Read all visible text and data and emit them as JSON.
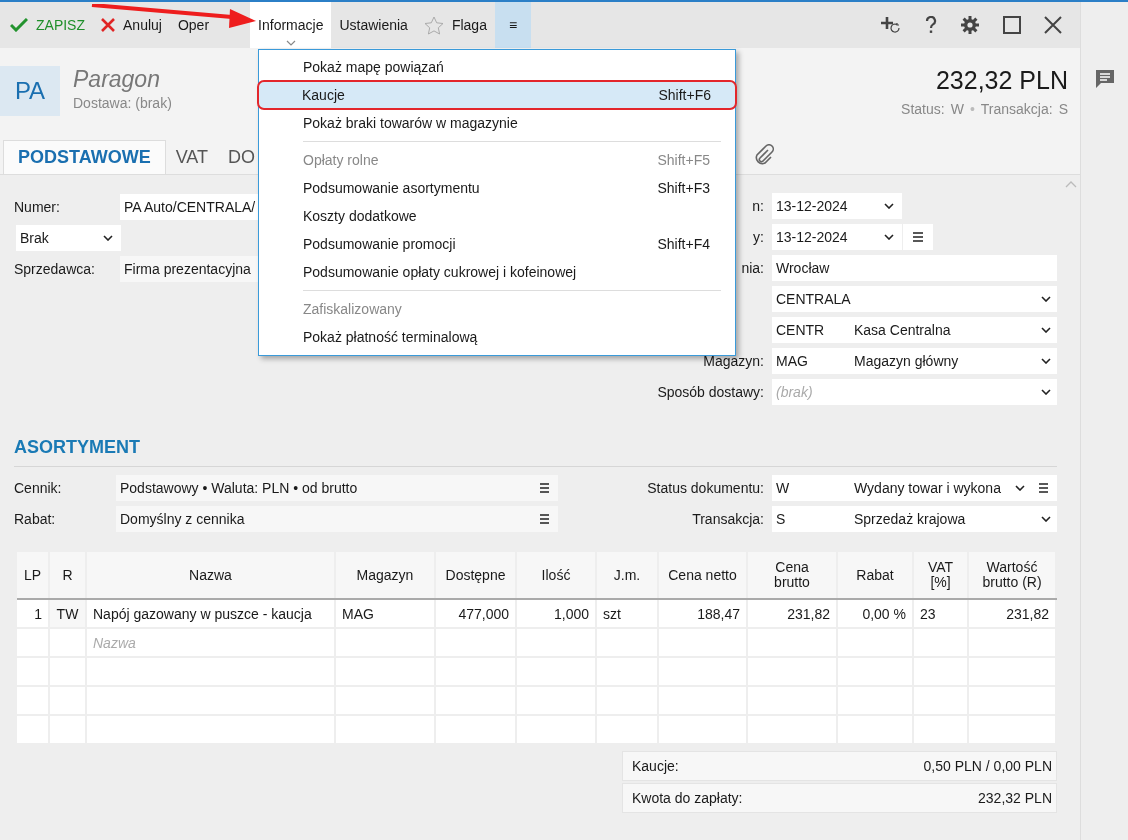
{
  "toolbar": {
    "items": [
      {
        "kind": "save",
        "label": "ZAPISZ",
        "selected": false
      },
      {
        "kind": "cancel",
        "label": "Anuluj",
        "selected": false
      },
      {
        "kind": "plain",
        "label": "Oper",
        "selected": false
      },
      {
        "kind": "dropdown",
        "label": "Informacje",
        "selected": true
      },
      {
        "kind": "plain",
        "label": "Ustawienia",
        "selected": false
      },
      {
        "kind": "flag",
        "label": "Flaga",
        "selected": false
      },
      {
        "kind": "more",
        "label": "≡",
        "selected": false
      }
    ]
  },
  "document": {
    "badge": "PA",
    "title": "Paragon",
    "subtitle": "Dostawa: (brak)",
    "total": "232,32 PLN",
    "status_label": "Status:",
    "status": "W",
    "separator": "•",
    "transaction_label": "Transakcja:",
    "transaction": "S"
  },
  "tabs": [
    {
      "label": "PODSTAWOWE",
      "selected": true
    },
    {
      "label": "VAT",
      "selected": false
    },
    {
      "label": "DO",
      "selected": false
    }
  ],
  "form_left": [
    {
      "kind": "text",
      "label": "Numer:",
      "value": "PA Auto/CENTRALA/"
    },
    {
      "kind": "select",
      "value": "Brak"
    },
    {
      "kind": "readonly",
      "label": "Sprzedawca:",
      "value": "Firma prezentacyjna"
    }
  ],
  "form_right": [
    {
      "kind": "date",
      "label": "n:",
      "value": "13-12-2024"
    },
    {
      "kind": "date_menu",
      "label": "y:",
      "value": "13-12-2024"
    },
    {
      "kind": "text",
      "label": "nia:",
      "value": "Wrocław"
    },
    {
      "kind": "select",
      "value": "CENTRALA"
    },
    {
      "kind": "select",
      "value": "CENTR",
      "name": "Kasa Centralna"
    },
    {
      "kind": "select",
      "label": "Magazyn:",
      "value": "MAG",
      "name": "Magazyn główny"
    },
    {
      "kind": "select",
      "label": "Sposób dostawy:",
      "placeholder": "(brak)"
    }
  ],
  "assortment": {
    "heading": "ASORTYMENT",
    "left": [
      {
        "label": "Cennik:",
        "value": "Podstawowy • Waluta: PLN • od brutto"
      },
      {
        "label": "Rabat:",
        "value": "Domyślny z cennika"
      }
    ],
    "right": [
      {
        "label": "Status dokumentu:",
        "value": "W",
        "name": "Wydany towar i wykona",
        "menu": true
      },
      {
        "label": "Transakcja:",
        "value": "S",
        "name": "Sprzedaż krajowa",
        "menu": false
      }
    ]
  },
  "table": {
    "columns": [
      "LP",
      "R",
      "Nazwa",
      "Magazyn",
      "Dostępne",
      "Ilość",
      "J.m.",
      "Cena netto",
      "Cena brutto",
      "Rabat",
      "VAT [%]",
      "Wartość brutto (R)"
    ],
    "rows": [
      [
        "1",
        "TW",
        "Napój gazowany w puszce - kaucja",
        "MAG",
        "477,000",
        "1,000",
        "szt",
        "188,47",
        "231,82",
        "0,00 %",
        "23",
        "231,82"
      ]
    ],
    "new_row_placeholder": "Nazwa"
  },
  "totals": [
    {
      "label": "Kaucje:",
      "value": "0,50 PLN / 0,00 PLN"
    },
    {
      "label": "Kwota do zapłaty:",
      "value": "232,32 PLN"
    }
  ],
  "menu": {
    "items": [
      {
        "kind": "item",
        "label": "Pokaż mapę powiązań",
        "disabled": false,
        "selected": false,
        "annotated": false
      },
      {
        "kind": "item",
        "label": "Kaucje",
        "shortcut": "Shift+F6",
        "disabled": false,
        "selected": true,
        "annotated": true
      },
      {
        "kind": "item",
        "label": "Pokaż braki towarów w magazynie",
        "disabled": false,
        "selected": false,
        "annotated": false
      },
      {
        "kind": "separator"
      },
      {
        "kind": "item",
        "label": "Opłaty rolne",
        "shortcut": "Shift+F5",
        "disabled": true,
        "selected": false,
        "annotated": false
      },
      {
        "kind": "item",
        "label": "Podsumowanie asortymentu",
        "shortcut": "Shift+F3",
        "disabled": false,
        "selected": false,
        "annotated": false
      },
      {
        "kind": "item",
        "label": "Koszty dodatkowe",
        "disabled": false,
        "selected": false,
        "annotated": false
      },
      {
        "kind": "item",
        "label": "Podsumowanie promocji",
        "shortcut": "Shift+F4",
        "disabled": false,
        "selected": false,
        "annotated": false
      },
      {
        "kind": "item",
        "label": "Podsumowanie opłaty cukrowej i kofeinowej",
        "disabled": false,
        "selected": false,
        "annotated": false
      },
      {
        "kind": "separator"
      },
      {
        "kind": "item",
        "label": "Zafiskalizowany",
        "disabled": true,
        "selected": false,
        "annotated": false
      },
      {
        "kind": "item",
        "label": "Pokaż płatność terminalową",
        "disabled": false,
        "selected": false,
        "annotated": false
      }
    ]
  }
}
